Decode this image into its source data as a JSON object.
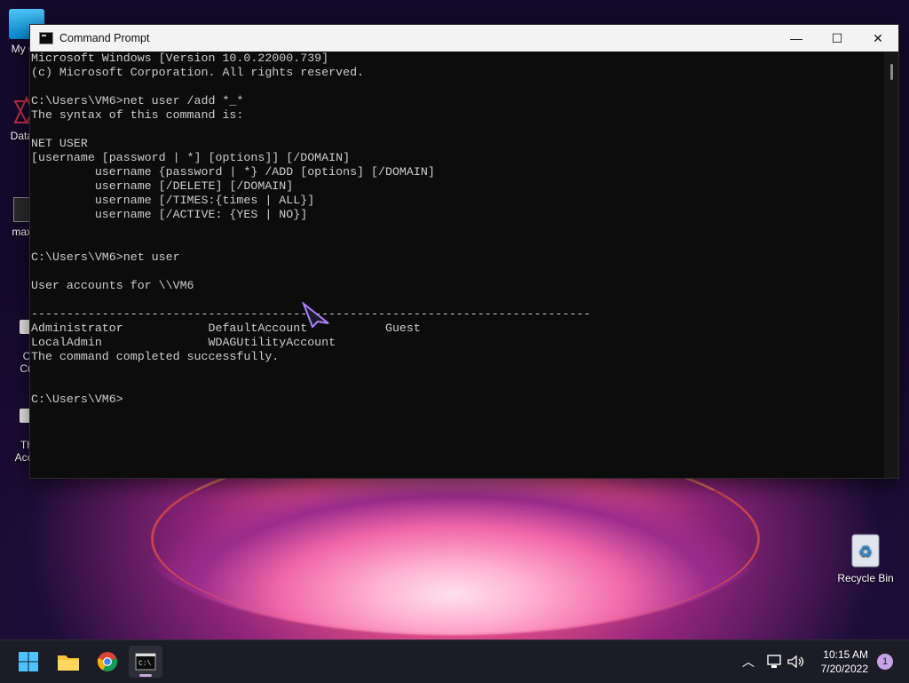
{
  "desktop": {
    "icons": [
      {
        "id": "my-computer",
        "label": "My Co"
      },
      {
        "id": "datawrapper",
        "label": "DataW"
      },
      {
        "id": "maxre",
        "label": "maxre"
      },
      {
        "id": "cu",
        "label": "Cu\nCu"
      },
      {
        "id": "theacce",
        "label": "The\nAcce"
      },
      {
        "id": "recycle-bin",
        "label": "Recycle Bin"
      }
    ]
  },
  "window": {
    "title": "Command Prompt",
    "controls": {
      "minimize": "—",
      "maximize": "☐",
      "close": "✕"
    },
    "console_lines": [
      "Microsoft Windows [Version 10.0.22000.739]",
      "(c) Microsoft Corporation. All rights reserved.",
      "",
      "C:\\Users\\VM6>net user /add *_*",
      "The syntax of this command is:",
      "",
      "NET USER",
      "[username [password | *] [options]] [/DOMAIN]",
      "         username {password | *} /ADD [options] [/DOMAIN]",
      "         username [/DELETE] [/DOMAIN]",
      "         username [/TIMES:{times | ALL}]",
      "         username [/ACTIVE: {YES | NO}]",
      "",
      "",
      "C:\\Users\\VM6>net user",
      "",
      "User accounts for \\\\VM6",
      "",
      "-------------------------------------------------------------------------------",
      "Administrator            DefaultAccount           Guest",
      "LocalAdmin               WDAGUtilityAccount",
      "The command completed successfully.",
      "",
      "",
      "C:\\Users\\VM6>"
    ]
  },
  "taskbar": {
    "items": [
      {
        "id": "start",
        "icon": "windows-logo-icon"
      },
      {
        "id": "file-explorer",
        "icon": "folder-icon"
      },
      {
        "id": "chrome",
        "icon": "chrome-icon"
      },
      {
        "id": "command-prompt",
        "icon": "terminal-icon",
        "active": true
      }
    ],
    "clock": {
      "time": "10:15 AM",
      "date": "7/20/2022"
    },
    "notification_count": "1"
  },
  "colors": {
    "console_bg": "#0c0c0c",
    "console_text": "#cccccc",
    "taskbar_bg": "#1c1c26",
    "accent": "#c6a2e8"
  }
}
